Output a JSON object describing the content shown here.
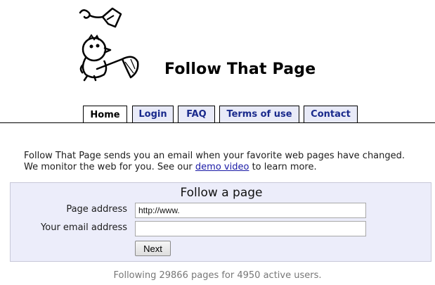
{
  "site": {
    "title": "Follow That Page"
  },
  "tabs": [
    {
      "label": "Home",
      "active": true
    },
    {
      "label": "Login",
      "active": false
    },
    {
      "label": "FAQ",
      "active": false
    },
    {
      "label": "Terms of use",
      "active": false
    },
    {
      "label": "Contact",
      "active": false
    }
  ],
  "intro": {
    "line1": "Follow That Page sends you an email when your favorite web pages have changed.",
    "line2_before": "We monitor the web for you. See our ",
    "line2_link": "demo video",
    "line2_after": " to learn more."
  },
  "form": {
    "title": "Follow a page",
    "page_address_label": "Page address",
    "page_address_value": "http://www.",
    "email_label": "Your email address",
    "email_value": "",
    "next_label": "Next"
  },
  "footer": {
    "stats": "Following 29866 pages for 4950 active users."
  },
  "colors": {
    "tab_text": "#1a2a8c",
    "tab_bg": "#e8eaf8",
    "panel_bg": "#ecedfa",
    "link": "#1a1aa6"
  },
  "icons": {
    "logo": "cartoon-bird-with-butterfly-net-logo"
  }
}
